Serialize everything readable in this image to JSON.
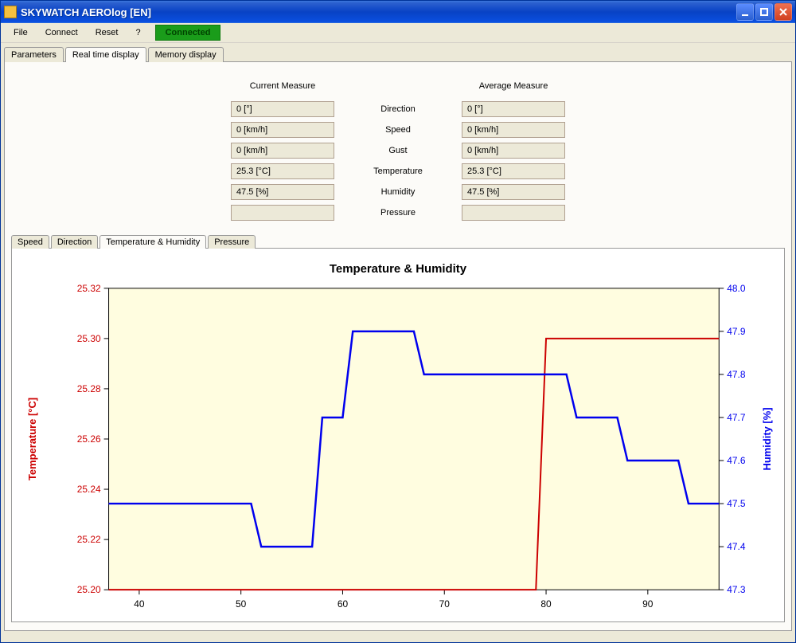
{
  "window": {
    "title": "SKYWATCH AEROlog [EN]"
  },
  "menu": {
    "file": "File",
    "connect": "Connect",
    "reset": "Reset",
    "help": "?",
    "status": "Connected"
  },
  "main_tabs": {
    "parameters": "Parameters",
    "realtime": "Real time display",
    "memory": "Memory display"
  },
  "measure": {
    "current_head": "Current Measure",
    "average_head": "Average Measure",
    "labels": {
      "direction": "Direction",
      "speed": "Speed",
      "gust": "Gust",
      "temperature": "Temperature",
      "humidity": "Humidity",
      "pressure": "Pressure"
    },
    "current": {
      "direction": "0 [°]",
      "speed": "0 [km/h]",
      "gust": "0 [km/h]",
      "temperature": "25.3 [°C]",
      "humidity": "47.5 [%]",
      "pressure": ""
    },
    "average": {
      "direction": "0 [°]",
      "speed": "0 [km/h]",
      "gust": "0 [km/h]",
      "temperature": "25.3 [°C]",
      "humidity": "47.5 [%]",
      "pressure": ""
    }
  },
  "sub_tabs": {
    "speed": "Speed",
    "direction": "Direction",
    "temphum": "Temperature & Humidity",
    "pressure": "Pressure"
  },
  "chart": {
    "title": "Temperature & Humidity",
    "ylabel_left": "Temperature [°C]",
    "ylabel_right": "Humidity [%]"
  },
  "chart_data": {
    "type": "line",
    "title": "Temperature & Humidity",
    "xlabel": "",
    "x_range": [
      37,
      97
    ],
    "x_ticks": [
      40,
      50,
      60,
      70,
      80,
      90
    ],
    "series": [
      {
        "name": "Temperature [°C]",
        "axis": "left",
        "color": "#cc0000",
        "ylim": [
          25.2,
          25.32
        ],
        "y_ticks": [
          25.2,
          25.22,
          25.24,
          25.26,
          25.28,
          25.3,
          25.32
        ],
        "points": [
          {
            "x": 37,
            "y": 25.2
          },
          {
            "x": 79,
            "y": 25.2
          },
          {
            "x": 80,
            "y": 25.3
          },
          {
            "x": 97,
            "y": 25.3
          }
        ]
      },
      {
        "name": "Humidity [%]",
        "axis": "right",
        "color": "#0000ee",
        "ylim": [
          47.3,
          48.0
        ],
        "y_ticks": [
          47.3,
          47.4,
          47.5,
          47.6,
          47.7,
          47.8,
          47.9,
          48.0
        ],
        "points": [
          {
            "x": 37,
            "y": 47.5
          },
          {
            "x": 51,
            "y": 47.5
          },
          {
            "x": 52,
            "y": 47.4
          },
          {
            "x": 57,
            "y": 47.4
          },
          {
            "x": 58,
            "y": 47.7
          },
          {
            "x": 60,
            "y": 47.7
          },
          {
            "x": 61,
            "y": 47.9
          },
          {
            "x": 67,
            "y": 47.9
          },
          {
            "x": 68,
            "y": 47.8
          },
          {
            "x": 82,
            "y": 47.8
          },
          {
            "x": 83,
            "y": 47.7
          },
          {
            "x": 87,
            "y": 47.7
          },
          {
            "x": 88,
            "y": 47.6
          },
          {
            "x": 93,
            "y": 47.6
          },
          {
            "x": 94,
            "y": 47.5
          },
          {
            "x": 97,
            "y": 47.5
          }
        ]
      }
    ]
  }
}
